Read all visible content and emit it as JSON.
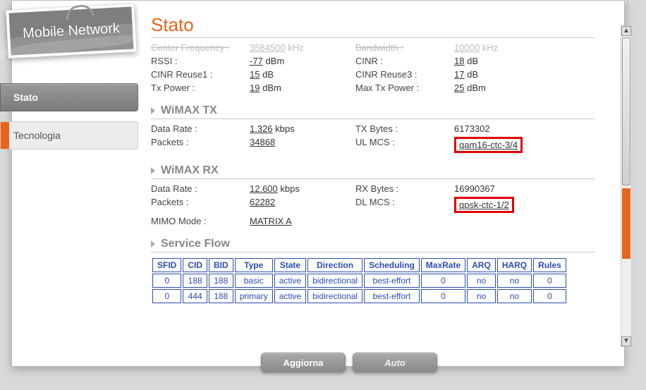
{
  "brand": "Mobile Network",
  "sidebar": {
    "items": [
      {
        "label": "Stato",
        "active": true
      },
      {
        "label": "Tecnologia",
        "active": false
      }
    ]
  },
  "page_title": "Stato",
  "top": {
    "center_freq_label": "Center Frequency :",
    "center_freq_val": "3584500",
    "center_freq_unit": "kHz",
    "bandwidth_label": "Bandwidth :",
    "bandwidth_val": "10000",
    "bandwidth_unit": "kHz",
    "rssi_label": "RSSI :",
    "rssi_val": "-77",
    "rssi_unit": "dBm",
    "cinr_label": "CINR :",
    "cinr_val": "18",
    "cinr_unit": "dB",
    "cinr_r1_label": "CINR Reuse1 :",
    "cinr_r1_val": "15",
    "cinr_r1_unit": "dB",
    "cinr_r3_label": "CINR Reuse3 :",
    "cinr_r3_val": "17",
    "cinr_r3_unit": "dB",
    "txpow_label": "Tx Power :",
    "txpow_val": "19",
    "txpow_unit": "dBm",
    "maxtx_label": "Max Tx Power :",
    "maxtx_val": "25",
    "maxtx_unit": "dBm"
  },
  "wimax_tx": {
    "title": "WiMAX TX",
    "datarate_label": "Data Rate :",
    "datarate_val": "1.326",
    "datarate_unit": "kbps",
    "txbytes_label": "TX Bytes :",
    "txbytes_val": "6173302",
    "packets_label": "Packets :",
    "packets_val": "34868",
    "ulmcs_label": "UL MCS :",
    "ulmcs_val": "qam16-ctc-3/4"
  },
  "wimax_rx": {
    "title": "WiMAX RX",
    "datarate_label": "Data Rate :",
    "datarate_val": "12.600",
    "datarate_unit": "kbps",
    "rxbytes_label": "RX Bytes :",
    "rxbytes_val": "16990367",
    "packets_label": "Packets :",
    "packets_val": "62282",
    "dlmcs_label": "DL MCS :",
    "dlmcs_val": "qpsk-ctc-1/2",
    "mimo_label": "MIMO Mode :",
    "mimo_val": "MATRIX A"
  },
  "service_flow": {
    "title": "Service Flow",
    "headers": [
      "SFID",
      "CID",
      "BID",
      "Type",
      "State",
      "Direction",
      "Scheduling",
      "MaxRate",
      "ARQ",
      "HARQ",
      "Rules"
    ],
    "rows": [
      [
        "0",
        "188",
        "188",
        "basic",
        "active",
        "bidirectional",
        "best-effort",
        "0",
        "no",
        "no",
        "0"
      ],
      [
        "0",
        "444",
        "188",
        "primary",
        "active",
        "bidirectional",
        "best-effort",
        "0",
        "no",
        "no",
        "0"
      ]
    ]
  },
  "buttons": {
    "refresh": "Aggiorna",
    "auto": "Auto"
  }
}
